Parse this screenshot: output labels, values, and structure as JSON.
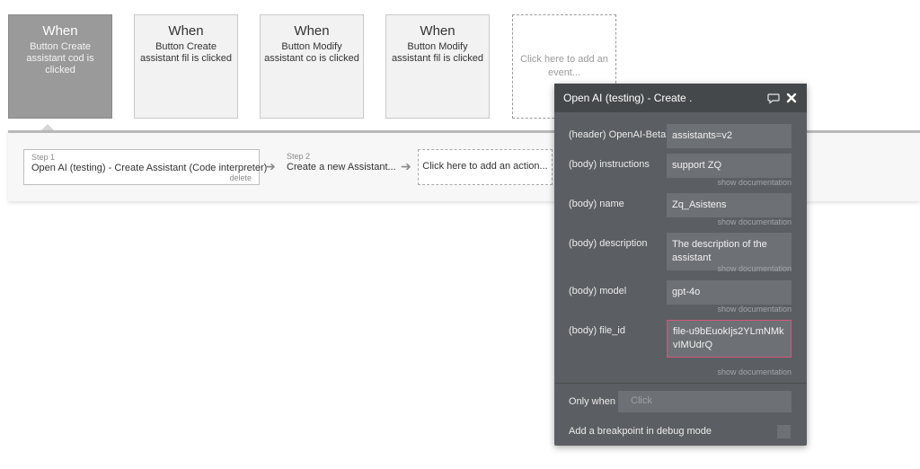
{
  "events": [
    {
      "when": "When",
      "description": "Button Create assistant cod is clicked",
      "selected": true
    },
    {
      "when": "When",
      "description": "Button Create assistant fil is clicked",
      "selected": false
    },
    {
      "when": "When",
      "description": "Button Modify assistant co is clicked",
      "selected": false
    },
    {
      "when": "When",
      "description": "Button Modify assistant fil is clicked",
      "selected": false
    }
  ],
  "add_event_label": "Click here to add an event...",
  "steps": {
    "step1_number": "Step 1",
    "step1_title": "Open AI (testing) - Create Assistant (Code interpreter)",
    "step1_delete": "delete",
    "arrow_icon": "arrow-right-icon",
    "step2_number": "Step 2",
    "step2_title": "Create a new Assistant...",
    "add_action_label": "Click here to add an action..."
  },
  "panel": {
    "title": "Open AI (testing) - Create .",
    "icons": [
      "comment-icon",
      "close-icon"
    ],
    "rows": [
      {
        "label": "(header) OpenAI-Beta",
        "value": "assistants=v2",
        "show_doc": ""
      },
      {
        "label": "(body) instructions",
        "value": "support ZQ",
        "show_doc": "show documentation"
      },
      {
        "label": "(body) name",
        "value": "Zq_Asistens",
        "show_doc": "show documentation"
      },
      {
        "label": "(body) description",
        "value": "The description of the assistant",
        "show_doc": "show documentation"
      },
      {
        "label": "(body) model",
        "value": "gpt-4o",
        "show_doc": "show documentation"
      },
      {
        "label": "(body) file_id",
        "value": "file-u9bEuokIjs2YLmNMkvIMUdrQ",
        "show_doc": "show documentation"
      }
    ],
    "only_when_label": "Only when",
    "only_when_placeholder": "Click",
    "breakpoint_label": "Add a breakpoint in debug mode"
  },
  "colors": {
    "panel_bg": "#5b5e62",
    "panel_header": "#45484b",
    "field_bg": "#6d7075",
    "error_border": "#d0587c",
    "selected_event": "#9a9a9a"
  }
}
